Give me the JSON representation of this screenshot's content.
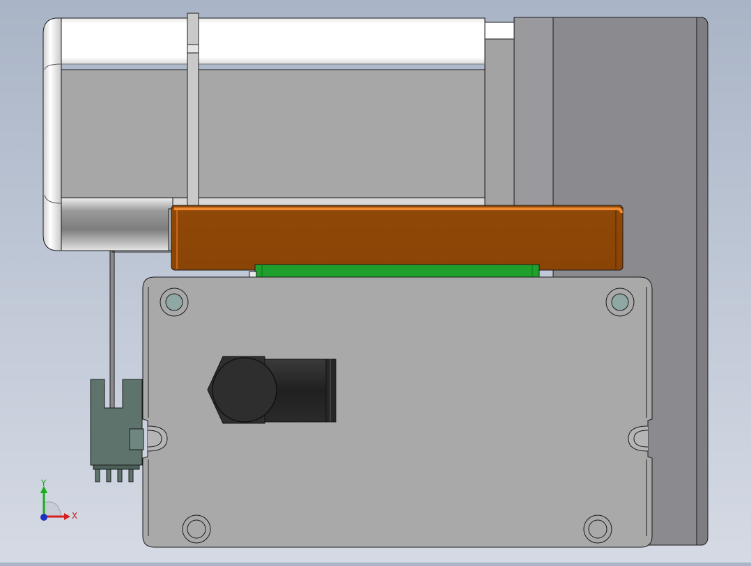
{
  "viewport": {
    "background_top": "#a9b4c6",
    "background_bottom": "#d5dae4"
  },
  "model": {
    "motor_body_color": "#a7a7a7",
    "motor_cap_color": "#ffffff",
    "end_block_color": "#8b8a8f",
    "bracket_color": "#8f4807",
    "bracket_edge_color": "#e87f2a",
    "pcb_strip_color": "#1fa02c",
    "base_plate_color": "#a9a9a9",
    "hole_fill_color": "#8fa8a4",
    "connector_color": "#5d736c",
    "fitting_color": "#2b2b2b"
  },
  "triad": {
    "x_label": "X",
    "y_label": "Y",
    "x_color": "#d42020",
    "y_color": "#18b018",
    "z_color": "#2030c0"
  }
}
